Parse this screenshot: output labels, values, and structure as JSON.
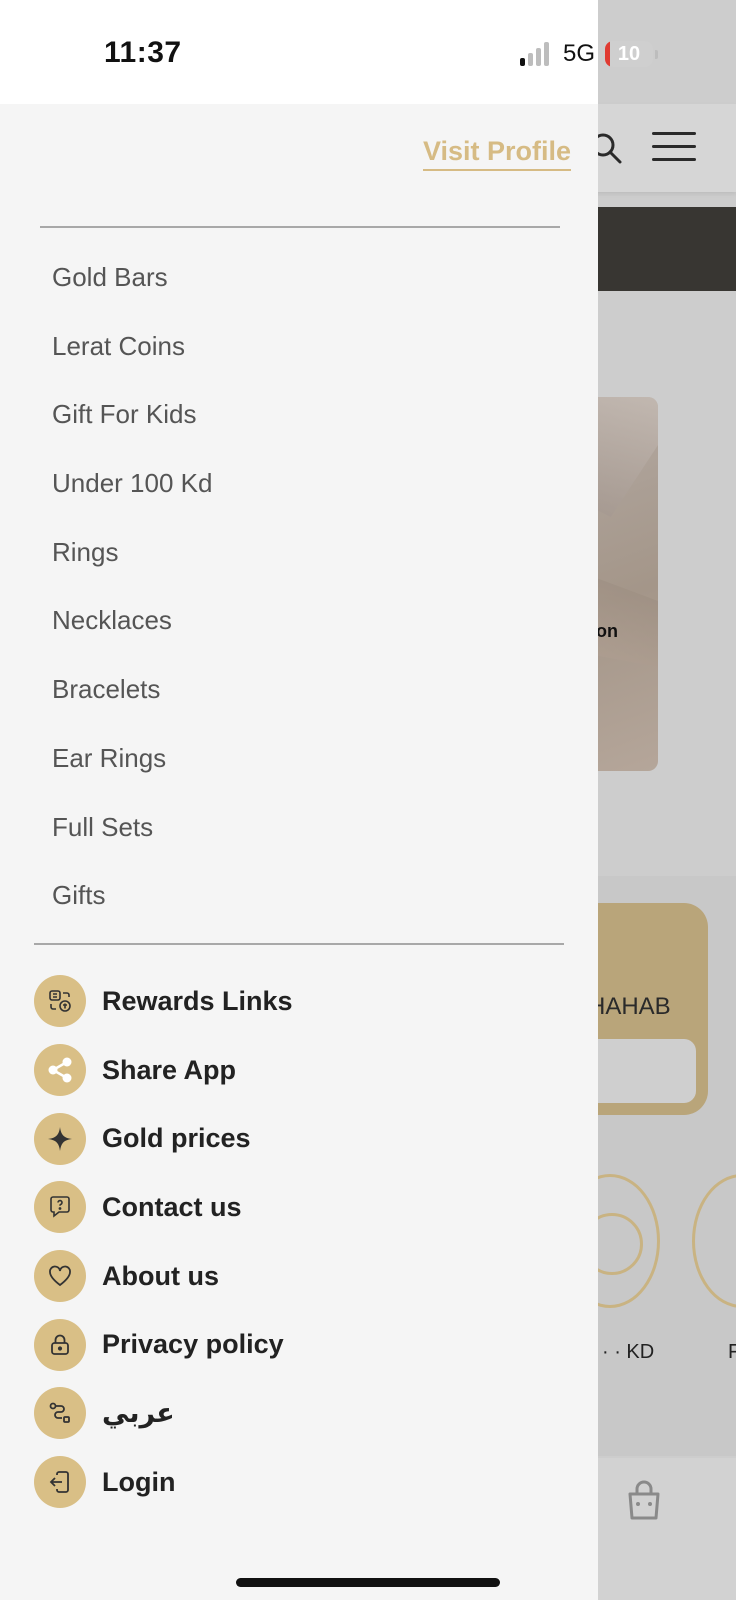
{
  "status_bar": {
    "time": "11:37",
    "network": "5G",
    "battery_level": "10",
    "battery_color": "#e03b32"
  },
  "drawer": {
    "visit_profile_label": "Visit Profile",
    "accent_color": "#d6bb84",
    "categories": [
      "Gold Bars",
      "Lerat Coins",
      "Gift For Kids",
      "Under 100 Kd",
      "Rings",
      "Necklaces",
      "Bracelets",
      "Ear Rings",
      "Full Sets",
      "Gifts"
    ],
    "links": [
      {
        "label": "Rewards Links",
        "icon": "rewards-icon"
      },
      {
        "label": "Share App",
        "icon": "share-icon"
      },
      {
        "label": "Gold prices",
        "icon": "sparkle-icon"
      },
      {
        "label": "Contact us",
        "icon": "chat-question-icon"
      },
      {
        "label": "About us",
        "icon": "heart-icon"
      },
      {
        "label": "Privacy policy",
        "icon": "lock-icon"
      },
      {
        "label": "عربي",
        "icon": "language-route-icon"
      },
      {
        "label": "Login",
        "icon": "login-icon"
      }
    ]
  },
  "background": {
    "card_text": "on",
    "gold_card_text": "HAHAB",
    "price_text": "· · KD",
    "partial_text": "F"
  }
}
